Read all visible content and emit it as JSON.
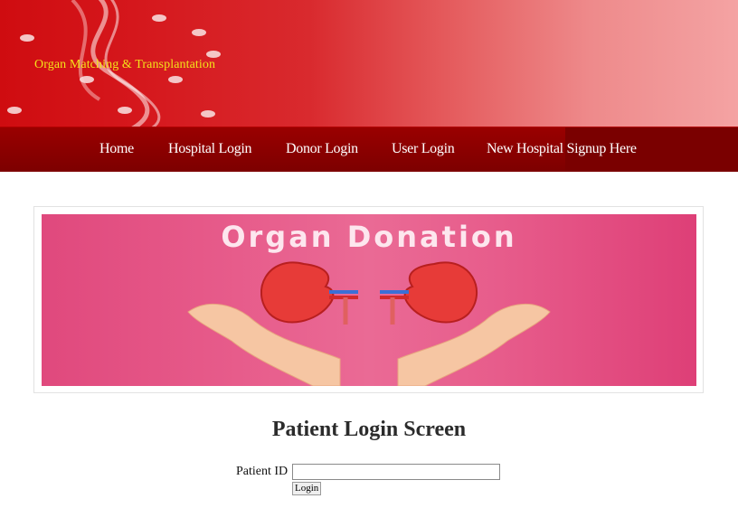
{
  "header": {
    "site_title": "Organ Matching & Transplantation"
  },
  "nav": {
    "items": [
      {
        "label": "Home"
      },
      {
        "label": "Hospital Login"
      },
      {
        "label": "Donor Login"
      },
      {
        "label": "User Login"
      },
      {
        "label": "New Hospital Signup Here"
      }
    ]
  },
  "banner_image": {
    "heading": "Organ Donation"
  },
  "login": {
    "title": "Patient Login Screen",
    "patient_id_label": "Patient ID",
    "patient_id_value": "",
    "submit_label": "Login"
  },
  "colors": {
    "header_red": "#d5171c",
    "nav_dark_red": "#8b0000",
    "title_yellow": "#f3e21a",
    "banner_pink": "#e75c8b"
  }
}
